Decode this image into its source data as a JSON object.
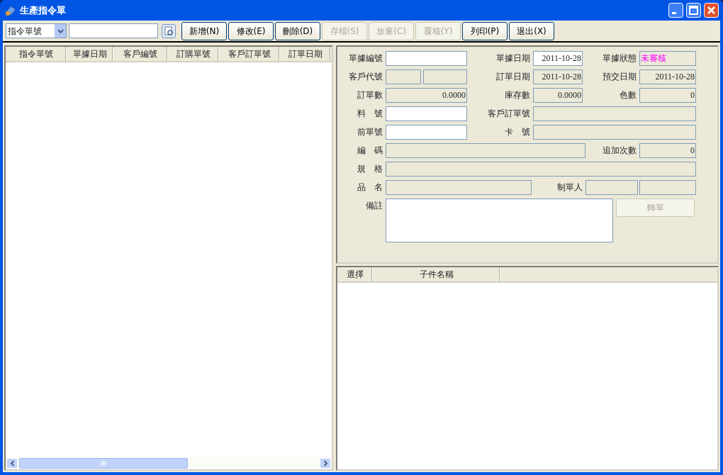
{
  "window": {
    "title": "生產指令單"
  },
  "toolbar": {
    "search_field_combo": "指令單號",
    "buttons": [
      {
        "label": "新增(N)",
        "disabled": false
      },
      {
        "label": "修改(E)",
        "disabled": false
      },
      {
        "label": "刪除(D)",
        "disabled": false
      },
      {
        "label": "存檔(S)",
        "disabled": true
      },
      {
        "label": "放棄(C)",
        "disabled": true
      },
      {
        "label": "覆核(Y)",
        "disabled": true
      },
      {
        "label": "列印(P)",
        "disabled": false
      },
      {
        "label": "退出(X)",
        "disabled": false
      }
    ]
  },
  "order_list": {
    "columns": [
      "指令單號",
      "單據日期",
      "客戶編號",
      "訂購單號",
      "客戶訂單號",
      "訂單日期"
    ]
  },
  "form_rows": [
    [
      {
        "kind": "label",
        "text": "單據編號"
      },
      {
        "kind": "field",
        "editable": true
      },
      {
        "kind": "label",
        "text": "單據日期"
      },
      {
        "kind": "field",
        "value": "2011-10-28",
        "editable": true
      },
      {
        "kind": "label",
        "text": "單據狀態"
      },
      {
        "kind": "field",
        "value": "未審核",
        "editable": false,
        "color": "#ff00ff"
      }
    ],
    [
      {
        "kind": "label",
        "text": "客戶代號"
      },
      {
        "kind": "field",
        "editable": false
      },
      {
        "kind": "field",
        "editable": false
      },
      {
        "kind": "label",
        "text": "訂單日期"
      },
      {
        "kind": "field",
        "value": "2011-10-28",
        "editable": false
      },
      {
        "kind": "label",
        "text": "預交日期"
      },
      {
        "kind": "field",
        "value": "2011-10-28",
        "editable": false
      }
    ],
    [
      {
        "kind": "label",
        "text": "訂單數"
      },
      {
        "kind": "field",
        "value": "0.0000",
        "editable": false
      },
      {
        "kind": "label",
        "text": "庫存數"
      },
      {
        "kind": "field",
        "value": "0.0000",
        "editable": false
      },
      {
        "kind": "label",
        "text": "色數"
      },
      {
        "kind": "field",
        "value": "0",
        "editable": false
      }
    ],
    [
      {
        "kind": "label",
        "text": "料　號"
      },
      {
        "kind": "field",
        "editable": true
      },
      {
        "kind": "label",
        "text": "客戶訂單號"
      },
      {
        "kind": "field",
        "editable": false
      }
    ],
    [
      {
        "kind": "label",
        "text": "前單號"
      },
      {
        "kind": "field",
        "editable": true
      },
      {
        "kind": "label",
        "text": "卡　號"
      },
      {
        "kind": "field",
        "editable": false
      }
    ],
    [
      {
        "kind": "label",
        "text": "編　碼"
      },
      {
        "kind": "field",
        "editable": false
      },
      {
        "kind": "label",
        "text": "追加次數"
      },
      {
        "kind": "field",
        "value": "0",
        "editable": false
      }
    ],
    [
      {
        "kind": "label",
        "text": "規　格"
      },
      {
        "kind": "field",
        "editable": false
      }
    ],
    [
      {
        "kind": "label",
        "text": "品　名"
      },
      {
        "kind": "field",
        "editable": false
      },
      {
        "kind": "label",
        "text": "制單人"
      },
      {
        "kind": "field",
        "editable": false
      },
      {
        "kind": "field",
        "editable": false
      }
    ],
    [
      {
        "kind": "label",
        "text": "備註"
      },
      {
        "kind": "memo",
        "editable": true
      },
      {
        "kind": "button",
        "text": "轉單",
        "disabled": true
      }
    ]
  ],
  "component_list": {
    "columns": [
      "選擇",
      "子件名稱"
    ]
  }
}
